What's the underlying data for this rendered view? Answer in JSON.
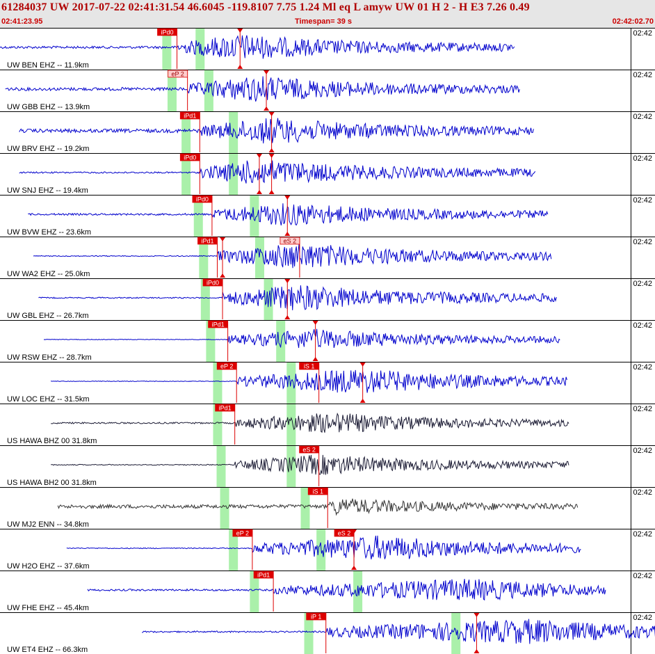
{
  "header": {
    "title": "61284037 UW 2017-07-22 02:41:31.54   46.6045 -119.8107   7.75  1.24 Ml  eq  L amyw    UW 01  H   2  -  H E3    7.26  0.49",
    "start_time": "02:41:23.95",
    "timespan_label": "Timespan=  39 s",
    "end_time": "02:42:02.70"
  },
  "chart_data": {
    "type": "line",
    "title": "61284037 UW 2017-07-22 02:41:31.54",
    "x_start": "02:41:23.95",
    "x_end": "02:42:02.70",
    "timespan_s": 39,
    "xlim_s": [
      0,
      38.75
    ],
    "minute_tick_label": "02:42",
    "minute_tick_s": 36.05,
    "colors": {
      "trace_blue": "#0000cc",
      "trace_black": "#1a1a33",
      "trace_gray": "#333333",
      "pick_red": "#dd0000",
      "window_green": "#aaf0aa",
      "separator": "#000000"
    },
    "series": [
      {
        "label": "UW BEN EHZ -- 11.9km",
        "color": "#0000cc",
        "start": 0.0,
        "end": 29.4,
        "onset": 10.1,
        "peak": 13.7,
        "amp": 0.9,
        "noise": 0.08,
        "windows": [
          9.5,
          11.4
        ],
        "picks": [
          {
            "label": "iPd0",
            "t": 10.1,
            "filled": true
          }
        ],
        "flags": [
          13.7
        ]
      },
      {
        "label": "UW GBB EHZ -- 13.9km",
        "color": "#0000cc",
        "start": 0.3,
        "end": 29.7,
        "onset": 10.7,
        "peak": 14.7,
        "amp": 0.9,
        "noise": 0.1,
        "windows": [
          9.8,
          11.9
        ],
        "picks": [
          {
            "label": "eP 2",
            "t": 10.7,
            "filled": false
          }
        ],
        "flags": [
          15.2
        ]
      },
      {
        "label": "UW BRV EHZ -- 19.2km",
        "color": "#0000cc",
        "start": 1.1,
        "end": 30.5,
        "onset": 11.4,
        "peak": 15.5,
        "amp": 0.9,
        "noise": 0.12,
        "windows": [
          10.6,
          13.3
        ],
        "picks": [
          {
            "label": "iPd1",
            "t": 11.4,
            "filled": true
          }
        ],
        "flags": [
          15.5
        ]
      },
      {
        "label": "UW SNJ EHZ -- 19.4km",
        "color": "#0000cc",
        "start": 1.1,
        "end": 30.6,
        "onset": 11.4,
        "peak": 14.8,
        "amp": 0.9,
        "noise": 0.05,
        "windows": [
          10.6,
          13.3
        ],
        "picks": [
          {
            "label": "iPd0",
            "t": 11.4,
            "filled": true
          }
        ],
        "flags": [
          14.8,
          15.5
        ]
      },
      {
        "label": "UW BVW EHZ -- 23.6km",
        "color": "#0000cc",
        "start": 1.6,
        "end": 31.3,
        "onset": 12.1,
        "peak": 16.4,
        "amp": 0.8,
        "noise": 0.06,
        "windows": [
          11.3,
          14.5
        ],
        "picks": [
          {
            "label": "iPd0",
            "t": 12.1,
            "filled": true
          }
        ],
        "flags": [
          16.4
        ]
      },
      {
        "label": "UW WA2 EHZ -- 25.0km",
        "color": "#0000cc",
        "start": 1.9,
        "end": 31.5,
        "onset": 12.4,
        "peak": 17.1,
        "amp": 0.9,
        "noise": 0.03,
        "windows": [
          11.6,
          14.8
        ],
        "picks": [
          {
            "label": "iPd1",
            "t": 12.4,
            "filled": true
          },
          {
            "label": "eS 2",
            "t": 17.1,
            "filled": false
          }
        ],
        "flags": [
          12.7
        ]
      },
      {
        "label": "UW GBL EHZ -- 26.7km",
        "color": "#0000cc",
        "start": 2.2,
        "end": 31.8,
        "onset": 12.7,
        "peak": 17.0,
        "amp": 0.9,
        "noise": 0.04,
        "windows": [
          11.7,
          15.3
        ],
        "picks": [
          {
            "label": "iPd0",
            "t": 12.7,
            "filled": true
          }
        ],
        "flags": [
          16.4
        ]
      },
      {
        "label": "UW RSW EHZ -- 28.7km",
        "color": "#0000cc",
        "start": 2.5,
        "end": 32.0,
        "onset": 13.0,
        "peak": 18.0,
        "amp": 0.7,
        "noise": 0.02,
        "windows": [
          12.0,
          16.0
        ],
        "picks": [
          {
            "label": "iPd1",
            "t": 13.0,
            "filled": true
          }
        ],
        "flags": [
          18.0
        ]
      },
      {
        "label": "UW LOC EHZ -- 31.5km",
        "color": "#0000cc",
        "start": 2.9,
        "end": 32.4,
        "onset": 13.5,
        "peak": 20.7,
        "amp": 0.85,
        "noise": 0.02,
        "windows": [
          12.4,
          16.6
        ],
        "picks": [
          {
            "label": "eP 2",
            "t": 13.5,
            "filled": true
          },
          {
            "label": "iS 1",
            "t": 18.2,
            "filled": true
          }
        ],
        "flags": [
          20.7
        ]
      },
      {
        "label": "US HAWA BHZ 00 31.8km",
        "color": "#1a1a33",
        "start": 2.9,
        "end": 32.5,
        "onset": 13.4,
        "peak": 19.0,
        "amp": 0.7,
        "noise": 0.05,
        "windows": [
          12.4,
          16.6
        ],
        "picks": [
          {
            "label": "iPd1",
            "t": 13.4,
            "filled": true
          }
        ],
        "flags": []
      },
      {
        "label": "US HAWA BH2 00 31.8km",
        "color": "#1a1a33",
        "start": 2.9,
        "end": 32.5,
        "onset": 13.4,
        "peak": 18.3,
        "amp": 0.7,
        "noise": 0.03,
        "windows": [
          12.6,
          16.6
        ],
        "picks": [
          {
            "label": "eS 2",
            "t": 18.2,
            "filled": true
          }
        ],
        "flags": []
      },
      {
        "label": "UW MJ2 ENN -- 34.8km",
        "color": "#333333",
        "start": 3.3,
        "end": 33.0,
        "onset": 18.7,
        "peak": 19.1,
        "amp": 0.6,
        "noise": 0.12,
        "windows": [
          12.8,
          17.4
        ],
        "picks": [
          {
            "label": "iS 1",
            "t": 18.7,
            "filled": true
          }
        ],
        "flags": []
      },
      {
        "label": "UW H2O EHZ -- 37.6km",
        "color": "#0000cc",
        "start": 3.8,
        "end": 33.2,
        "onset": 14.4,
        "peak": 21.8,
        "amp": 0.85,
        "noise": 0.03,
        "windows": [
          13.3,
          18.3
        ],
        "picks": [
          {
            "label": "eP 2",
            "t": 14.4,
            "filled": true
          },
          {
            "label": "eS 2",
            "t": 20.2,
            "filled": true
          }
        ],
        "flags": [
          20.2
        ]
      },
      {
        "label": "UW FHE EHZ -- 45.4km",
        "color": "#0000cc",
        "start": 5.0,
        "end": 34.6,
        "onset": 15.6,
        "peak": 27.0,
        "amp": 0.75,
        "noise": 0.06,
        "windows": [
          14.5,
          20.4
        ],
        "picks": [
          {
            "label": "iPd1",
            "t": 15.6,
            "filled": true
          }
        ],
        "flags": []
      },
      {
        "label": "UW ET4 EHZ -- 66.3km",
        "color": "#0000cc",
        "start": 8.1,
        "end": 38.7,
        "onset": 18.6,
        "peak": 30.5,
        "amp": 0.85,
        "noise": 0.05,
        "windows": [
          17.6,
          26.0
        ],
        "picks": [
          {
            "label": "iP 1",
            "t": 18.6,
            "filled": true
          }
        ],
        "flags": [
          27.2
        ]
      }
    ]
  }
}
